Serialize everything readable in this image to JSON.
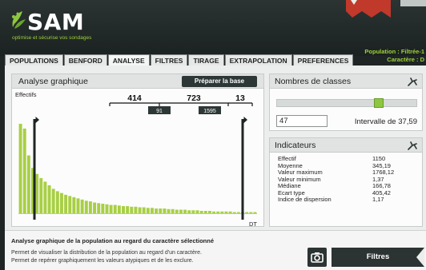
{
  "app": {
    "logo_text": "SAM",
    "tagline": "optimise et sécurise vos sondages",
    "population_line1": "Population : Filtrée-1",
    "population_line2": "Caractère : D",
    "ribbon_color": "#c0392b",
    "brand_color": "#8dc63f"
  },
  "tabs": [
    {
      "label": "POPULATIONS"
    },
    {
      "label": "BENFORD"
    },
    {
      "label": "ANALYSE"
    },
    {
      "label": "FILTRES"
    },
    {
      "label": "TIRAGE"
    },
    {
      "label": "EXTRAPOLATION"
    },
    {
      "label": "PREFERENCES"
    }
  ],
  "analysis_panel": {
    "title": "Analyse graphique",
    "prepare_button": "Préparer la base"
  },
  "chart_data": {
    "type": "bar",
    "ylabel": "Effectifs",
    "xlabel": "DT",
    "segment_counts": [
      414,
      723,
      13
    ],
    "thresholds": [
      91,
      1595
    ],
    "values": [
      150,
      142,
      97,
      76,
      66,
      59,
      53,
      47,
      41,
      37,
      34,
      31,
      29,
      27,
      25,
      23,
      21,
      20,
      18,
      17,
      16,
      15,
      14,
      14,
      13,
      12,
      12,
      11,
      11,
      10,
      10,
      9,
      9,
      8,
      8,
      8,
      7,
      7,
      6,
      6,
      6,
      5,
      5,
      5,
      4,
      4,
      4,
      3,
      3,
      3,
      3,
      3,
      2,
      2,
      2,
      2,
      2,
      2
    ],
    "color": "#a8cf45"
  },
  "classes_panel": {
    "title": "Nombres de classes",
    "value": "47",
    "interval": "Intervalle de 37,59",
    "slider_level": 0.74
  },
  "indicators_panel": {
    "title": "Indicateurs",
    "rows": [
      {
        "label": "Effectif",
        "value": "1150"
      },
      {
        "label": "Moyenne",
        "value": "345,19"
      },
      {
        "label": "Valeur maximum",
        "value": "1768,12"
      },
      {
        "label": "Valeur minimum",
        "value": "1,37"
      },
      {
        "label": "Médiane",
        "value": "166,78"
      },
      {
        "label": "Ecart type",
        "value": "405,42"
      },
      {
        "label": "Indice de dispersion",
        "value": "1,17"
      }
    ]
  },
  "footer": {
    "title": "Analyse graphique de la population au regard du caractère sélectionné",
    "line1": "Permet de visualiser la distribution de la population au regard d'un caractère.",
    "line2": "Permet de repérer graphiquement les valeurs atypiques et de les exclure.",
    "filter_button": "Filtres"
  }
}
